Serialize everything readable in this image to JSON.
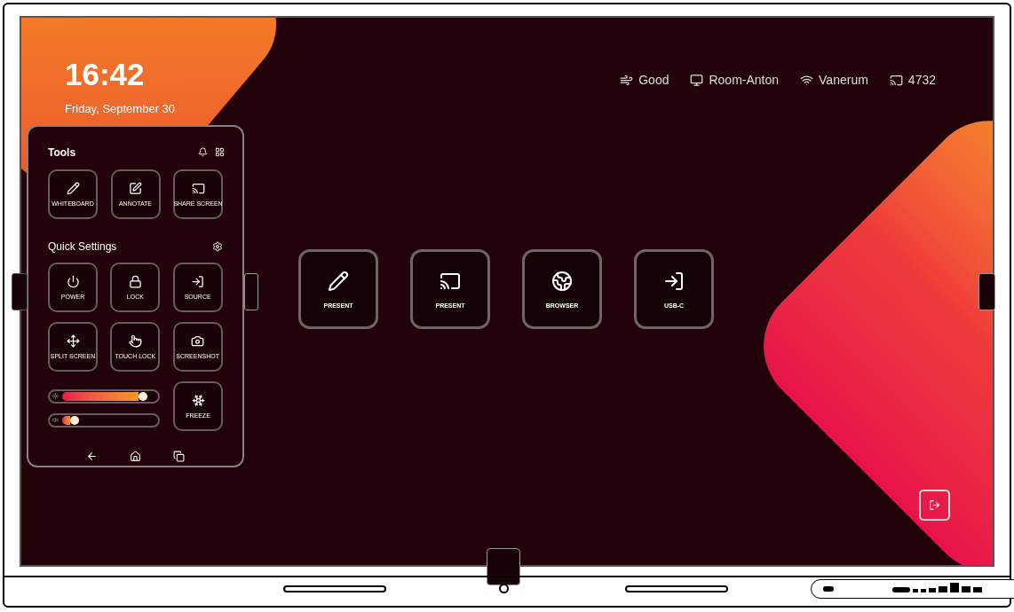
{
  "clock": {
    "time": "16:42",
    "date": "Friday, September 30"
  },
  "status_bar": [
    {
      "label": "Good"
    },
    {
      "label": "Room-Anton"
    },
    {
      "label": "Vanerum"
    },
    {
      "label": "4732"
    }
  ],
  "tools": {
    "title": "Tools",
    "items": [
      {
        "label": "WHITEBOARD"
      },
      {
        "label": "ANNOTATE"
      },
      {
        "label": "SHARE SCREEN"
      }
    ]
  },
  "quick_settings": {
    "title": "Quick Settings",
    "items": [
      {
        "label": "POWER"
      },
      {
        "label": "LOCK"
      },
      {
        "label": "SOURCE"
      },
      {
        "label": "SPLIT SCREEN"
      },
      {
        "label": "TOUCH LOCK"
      },
      {
        "label": "SCREENSHOT"
      }
    ],
    "sliders": [
      {
        "level": 0.85
      },
      {
        "level": 0.24
      }
    ],
    "freeze": {
      "label": "FREEZE"
    }
  },
  "apps": [
    {
      "label": "PRESENT"
    },
    {
      "label": "PRESENT"
    },
    {
      "label": "BROWSER"
    },
    {
      "label": "USB-C"
    }
  ]
}
